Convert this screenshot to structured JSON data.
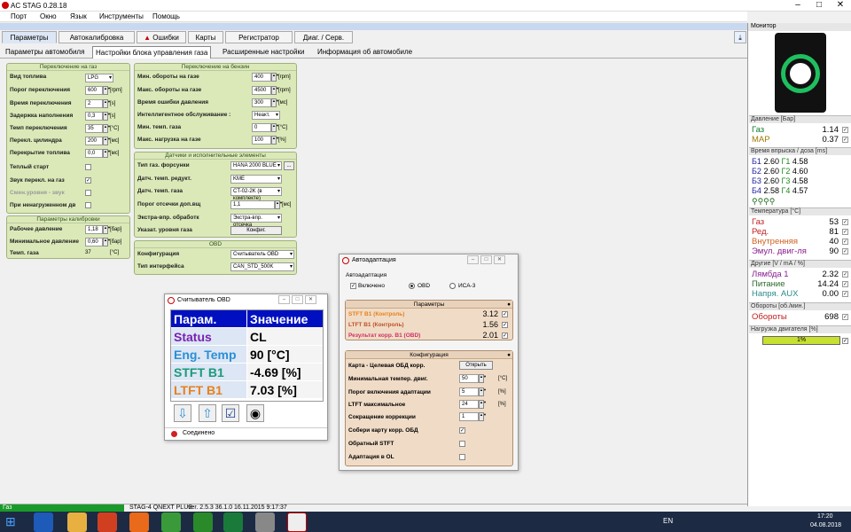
{
  "app_title": "AC STAG 0.28.18",
  "menu": [
    "Порт",
    "Окно",
    "Язык",
    "Инструменты",
    "Помощь"
  ],
  "main_tabs": [
    "Параметры",
    "Автокалибровка",
    "Ошибки",
    "Карты",
    "Регистратор",
    "Диаг. / Серв."
  ],
  "sub_tabs": [
    "Параметры автомобиля",
    "Настройки блока управления газа",
    "Расширенные настройки",
    "Информация об автомобиле"
  ],
  "switch_gas": {
    "title": "Переключение на газ",
    "rows": [
      {
        "label": "Вид топлива",
        "value": "LPG",
        "unit": ""
      },
      {
        "label": "Порог переключения",
        "value": "600",
        "unit": "[rpm]"
      },
      {
        "label": "Время переключения",
        "value": "2",
        "unit": "[s]"
      },
      {
        "label": "Задержка наполнения",
        "value": "0,3",
        "unit": "[s]"
      },
      {
        "label": "Темп переключения",
        "value": "35",
        "unit": "[°C]"
      },
      {
        "label": "Перекл. цилиндра",
        "value": "200",
        "unit": "[мс]"
      },
      {
        "label": "Перекрытие топлива",
        "value": "0,0",
        "unit": "[мс]"
      }
    ],
    "checks": [
      {
        "label": "Теплый старт",
        "checked": false
      },
      {
        "label": "Звук перекл. на газ",
        "checked": true
      },
      {
        "label": "Смен.уровня - звук",
        "checked": false
      },
      {
        "label": "При ненагруженном дв",
        "checked": false
      }
    ]
  },
  "calib": {
    "title": "Параметры калибровки",
    "rows": [
      {
        "label": "Рабочее давление",
        "value": "1,18",
        "unit": "[бар]"
      },
      {
        "label": "Минимальное давление",
        "value": "0,60",
        "unit": "[бар]"
      },
      {
        "label": "Темп. газа",
        "value": "37",
        "unit": "[°C]"
      }
    ]
  },
  "switch_petrol": {
    "title": "Переключение на бензин",
    "rows": [
      {
        "label": "Мин. обороты на газе",
        "value": "400",
        "unit": "[rpm]"
      },
      {
        "label": "Макс. обороты на газе",
        "value": "4500",
        "unit": "[rpm]"
      },
      {
        "label": "Время ошибки давления",
        "value": "300",
        "unit": "[мс]"
      },
      {
        "label": "Интеллигентное обслуживание :",
        "value": "Неакт.",
        "unit": ""
      },
      {
        "label": "Мин. темп. газа",
        "value": "0",
        "unit": "[°C]"
      },
      {
        "label": "Макс. нагрузка на газе",
        "value": "100",
        "unit": "[%]"
      }
    ]
  },
  "sensors": {
    "title": "Датчики и исполнительные элементы",
    "rows": [
      {
        "label": "Тип газ. форсунки",
        "value": "HANA 2000 BLUE"
      },
      {
        "label": "Датч. темп. редукт.",
        "value": "KME"
      },
      {
        "label": "Датч. темп. газа",
        "value": "CT-02-2K (в комплекте)"
      },
      {
        "label": "Порог отсечки доп.вщ",
        "value": "1,1",
        "unit": "[мс]"
      },
      {
        "label": "Экстра-впр. обработк",
        "value": "Экстра-впр. отсечка"
      },
      {
        "label": "Указат. уровня газа",
        "value": "Конфиг."
      }
    ]
  },
  "obd": {
    "title": "OBD",
    "rows": [
      {
        "label": "Конфигурация",
        "value": "Считыватель OBD"
      },
      {
        "label": "Тип интерфейса",
        "value": "CAN_STD_500K"
      }
    ]
  },
  "obd_reader": {
    "title": "Считыватель OBD",
    "header": [
      "Парам.",
      "Значение"
    ],
    "rows": [
      {
        "name": "Status",
        "value": "CL",
        "color": "#7a1fb0"
      },
      {
        "name": "Eng. Temp",
        "value": "90 [°C]",
        "color": "#2a8fd6"
      },
      {
        "name": "STFT B1",
        "value": "-4.69 [%]",
        "color": "#1a9a7a"
      },
      {
        "name": "LTFT B1",
        "value": "7.03 [%]",
        "color": "#e8801a"
      }
    ],
    "status_text": "Соединено"
  },
  "autoadapt": {
    "title": "Автоадаптация",
    "group": "Автоадаптация",
    "enabled_label": "Включено",
    "radio1": "OBD",
    "radio2": "ИСА-3",
    "params_title": "Параметры",
    "params": [
      {
        "label": "STFT B1 (Контроль)",
        "value": "3.12",
        "color": "#e8801a"
      },
      {
        "label": "LTFT B1 (Контроль)",
        "value": "1.56",
        "color": "#c0502a"
      },
      {
        "label": "Результат корр. B1 (OBD)",
        "value": "2.01",
        "color": "#d0306a"
      }
    ],
    "config_title": "Конфигурация",
    "config": [
      {
        "label": "Карта - Целевая ОБД корр.",
        "value": "Открыть",
        "unit": ""
      },
      {
        "label": "Минимальная темпер. двиг.",
        "value": "50",
        "unit": "[°C]"
      },
      {
        "label": "Порог включения адаптации",
        "value": "5",
        "unit": "[%]"
      },
      {
        "label": "LTFT максимальное",
        "value": "24",
        "unit": "[%]"
      },
      {
        "label": "Сокращение коррекции",
        "value": "1",
        "unit": ""
      },
      {
        "label": "Собери карту корр. ОБД",
        "value": "",
        "unit": ""
      },
      {
        "label": "Обратный STFT",
        "value": "",
        "unit": ""
      },
      {
        "label": "Адаптация в OL",
        "value": "",
        "unit": ""
      }
    ]
  },
  "monitor": {
    "title": "Монитор",
    "pressure_title": "Давление [Бар]",
    "pressure": [
      {
        "label": "Газ",
        "value": "1.14",
        "color": "#0a7a2a"
      },
      {
        "label": "MAP",
        "value": "0.37",
        "color": "#a07a00"
      }
    ],
    "inj_title": "Время впрыска / доза [ms]",
    "inj": [
      {
        "b": "Б1",
        "bv": "2.60",
        "g": "Г1",
        "gv": "4.58"
      },
      {
        "b": "Б2",
        "bv": "2.60",
        "g": "Г2",
        "gv": "4.60"
      },
      {
        "b": "Б3",
        "bv": "2.60",
        "g": "Г3",
        "gv": "4.58"
      },
      {
        "b": "Б4",
        "bv": "2.58",
        "g": "Г4",
        "gv": "4.57"
      }
    ],
    "temp_title": "Температура [°C]",
    "temp": [
      {
        "label": "Газ",
        "value": "53",
        "color": "#c02020"
      },
      {
        "label": "Ред.",
        "value": "81",
        "color": "#c02020"
      },
      {
        "label": "Внутренняя",
        "value": "40",
        "color": "#d06020"
      },
      {
        "label": "Эмул. двиг-ля",
        "value": "90",
        "color": "#8a2090"
      }
    ],
    "other_title": "Другие [V / mA / %]",
    "other": [
      {
        "label": "Лямбда 1",
        "value": "2.32",
        "color": "#8a2090"
      },
      {
        "label": "Питание",
        "value": "14.24",
        "color": "#2a6a2a"
      },
      {
        "label": "Напря. AUX",
        "value": "0.00",
        "color": "#2a8a8a"
      }
    ],
    "rpm_title": "Обороты [об./мин.]",
    "rpm": {
      "label": "Обороты",
      "value": "698",
      "color": "#c02020"
    },
    "load_title": "Нагрузка двигателя [%]",
    "load": {
      "value": "1%",
      "fraction": 0.01
    }
  },
  "status": {
    "gas": "Газ",
    "device": "STAG-4 QNEXT PLUS",
    "version": "ver. 2.5.3  36.1.0",
    "date": "16.11.2015 9:17:37"
  },
  "taskbar": {
    "lang": "EN",
    "time": "17:20",
    "date": "04.08.2018"
  }
}
